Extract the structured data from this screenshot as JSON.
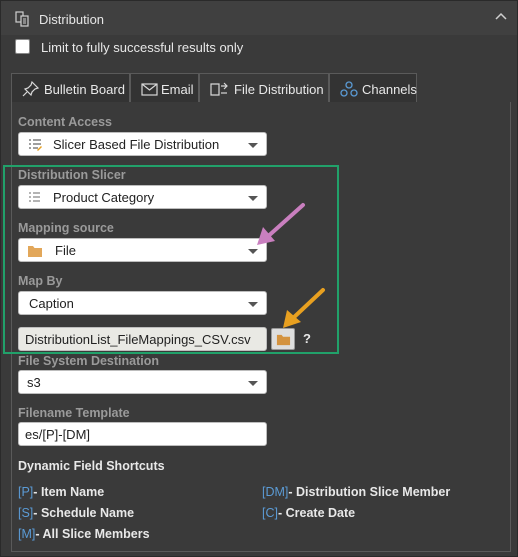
{
  "header": {
    "title": "Distribution",
    "icon": "distribution-icon",
    "collapse_icon": "chevron-up-icon"
  },
  "limit_checkbox": {
    "label": "Limit to fully successful results only",
    "checked": false
  },
  "tabs": [
    {
      "label": "Bulletin Board",
      "icon": "pin-icon",
      "active": false
    },
    {
      "label": "Email",
      "icon": "email-icon",
      "active": false
    },
    {
      "label": "File Distribution",
      "icon": "file-distribution-icon",
      "active": true
    },
    {
      "label": "Channels",
      "icon": "channels-icon",
      "active": false
    }
  ],
  "content_access": {
    "label": "Content Access",
    "value": "Slicer Based File Distribution"
  },
  "distribution_slicer": {
    "label": "Distribution Slicer",
    "value": "Product Category"
  },
  "mapping_source": {
    "label": "Mapping source",
    "value": "File"
  },
  "map_by": {
    "label": "Map By",
    "value": "Caption"
  },
  "mapping_file": {
    "value": "DistributionList_FileMappings_CSV.csv",
    "help": "?"
  },
  "file_system_destination": {
    "label": "File System Destination",
    "value": "s3"
  },
  "filename_template": {
    "label": "Filename Template",
    "value": "es/[P]-[DM]"
  },
  "shortcuts": {
    "heading": "Dynamic Field Shortcuts",
    "items": [
      {
        "key": "[P]",
        "sep": "- ",
        "name": "Item Name"
      },
      {
        "key": "[DM]",
        "sep": "- ",
        "name": "Distribution Slice Member"
      },
      {
        "key": "[S]",
        "sep": "- ",
        "name": "Schedule Name"
      },
      {
        "key": "[C]",
        "sep": "- ",
        "name": "Create Date"
      },
      {
        "key": "[M]",
        "sep": "- ",
        "name": "All Slice Members"
      }
    ]
  },
  "colors": {
    "panel_bg": "#3a3a3a",
    "highlight_box": "#21a16a",
    "arrow_pink": "#c97fbf",
    "arrow_orange": "#e8a020",
    "shortcut_key": "#5b9bd5"
  }
}
